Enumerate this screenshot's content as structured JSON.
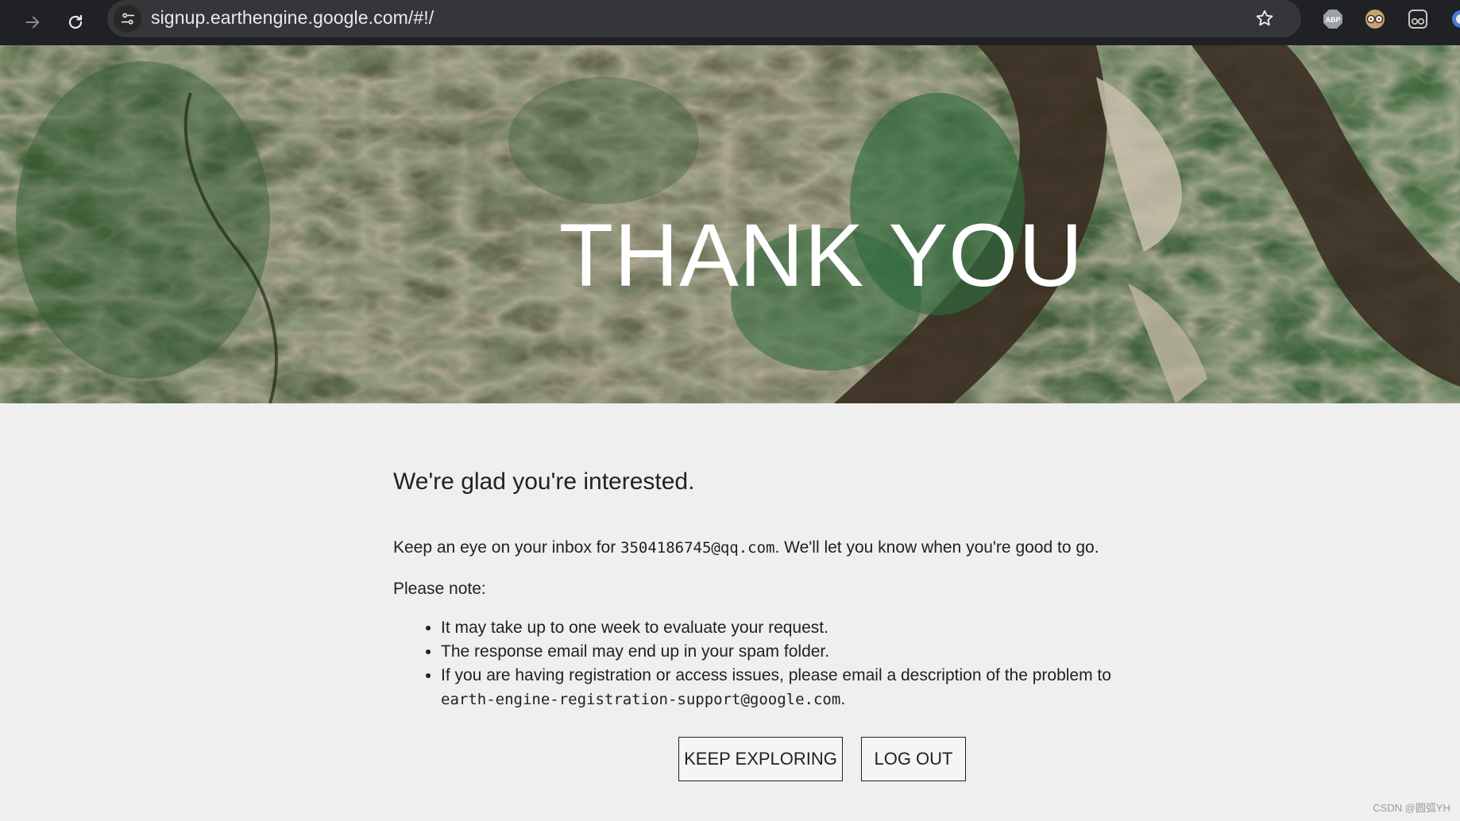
{
  "browser": {
    "url": "signup.earthengine.google.com/#!/",
    "icons": [
      "back-arrow-icon",
      "reload-icon",
      "site-info-icon",
      "bookmark-star-icon",
      "adblock-plus-icon",
      "glasses-extension-icon",
      "reader-extension-icon",
      "extension-icon"
    ],
    "abp_label": "ABP"
  },
  "hero": {
    "title": "THANK YOU"
  },
  "content": {
    "headline": "We're glad you're interested.",
    "inbox_prefix": "Keep an eye on your inbox for ",
    "email": "3504186745@qq.com",
    "inbox_suffix": ". We'll let you know when you're good to go.",
    "note_label": "Please note:",
    "notes": [
      "It may take up to one week to evaluate your request.",
      "The response email may end up in your spam folder.",
      "If you are having registration or access issues, please email a description of the problem to "
    ],
    "support_email": "earth-engine-registration-support@google.com",
    "support_suffix": "."
  },
  "buttons": {
    "keep_exploring": "KEEP EXPLORING",
    "log_out": "LOG OUT"
  },
  "watermark": "CSDN @圆弧YH",
  "colors": {
    "chrome_bg": "#202124",
    "omnibox_bg": "#35363a",
    "page_bg": "#efefef",
    "text": "#202124"
  }
}
